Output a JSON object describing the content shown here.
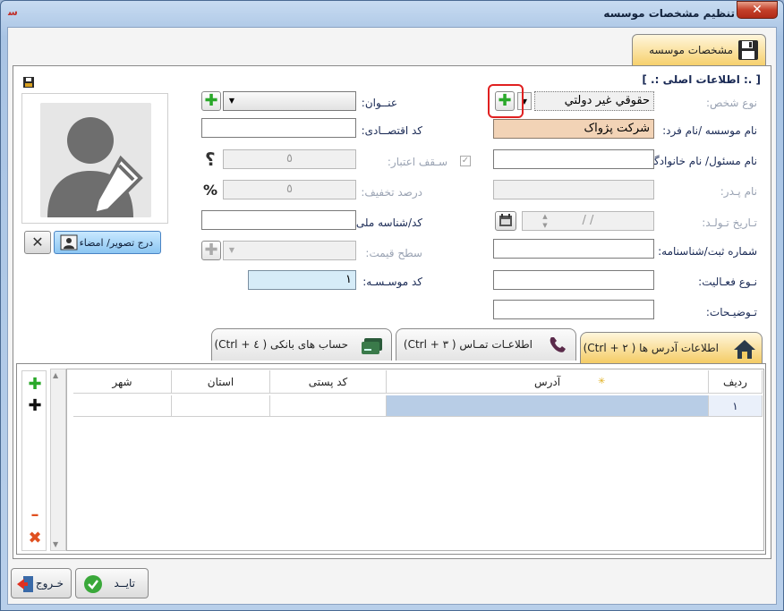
{
  "window": {
    "title": "تنظیم مشخصات موسسه",
    "close_glyph": "✕"
  },
  "top_tab": {
    "label": "مشخصات موسسه"
  },
  "section": {
    "title": "[ .: اطلاعات اصلی :. ]"
  },
  "form": {
    "person_type_label": "نوع شخص:",
    "person_type_value": "حقوقي غير دولتي",
    "company_name_label": "نام موسسه /نام فرد:",
    "company_name_value": "شرکت پژواک",
    "responsible_label": "نام مسئول/ نام خانوادگی:",
    "responsible_value": "",
    "father_label": "نام پـدر:",
    "father_value": "",
    "birth_label": "تـاریخ تـولـد:",
    "birth_value": "/    /",
    "registration_label": "شماره ثبت/شناسنامه:",
    "registration_value": "",
    "activity_label": "نـوع فعـالیت:",
    "activity_value": "",
    "description_label": "تـوضیـحات:",
    "description_value": "",
    "title_label": "عنــوان:",
    "title_value": "",
    "economic_code_label": "کد اقتصــادی:",
    "economic_code_value": "",
    "credit_ceiling_label": "سـقف اعتبار:",
    "credit_ceiling_value": "٥",
    "discount_label": "درصد تخفیف:",
    "discount_value": "٥",
    "national_id_label": "کد/شناسه ملی:",
    "national_id_value": "",
    "price_level_label": "سطح قیمت:",
    "price_level_value": "",
    "company_code_label": "کد موسـسـه:",
    "company_code_value": "١",
    "question_glyph": "؟",
    "percent_glyph": "%"
  },
  "image": {
    "insert_label": "درج تصویر/ امضاء",
    "remove_glyph": "✕"
  },
  "tabs": [
    {
      "label": "اطلاعات آدرس ها  ( ٢ + Ctrl)",
      "active": true
    },
    {
      "label": "اطلاعـات تمـاس  ( ٣ + Ctrl)",
      "active": false
    },
    {
      "label": "حساب های بانکی ( ٤ + Ctrl)",
      "active": false
    }
  ],
  "grid": {
    "columns": [
      "ردیف",
      "آدرس",
      "کد پستی",
      "استان",
      "شهر"
    ],
    "rows": [
      [
        "١",
        "",
        "",
        "",
        ""
      ]
    ],
    "required_marker": "✳"
  },
  "side_toolbar": {
    "add_glyph": "✚",
    "insert_glyph": "✚",
    "remove_glyph": "–",
    "delete_glyph": "✖"
  },
  "bottom": {
    "confirm_label": "تایــد",
    "exit_label": "خـروج"
  },
  "colors": {
    "accent_green": "#2aa82a",
    "highlight_red": "#e02020",
    "tab_active": "#f4cb62"
  }
}
